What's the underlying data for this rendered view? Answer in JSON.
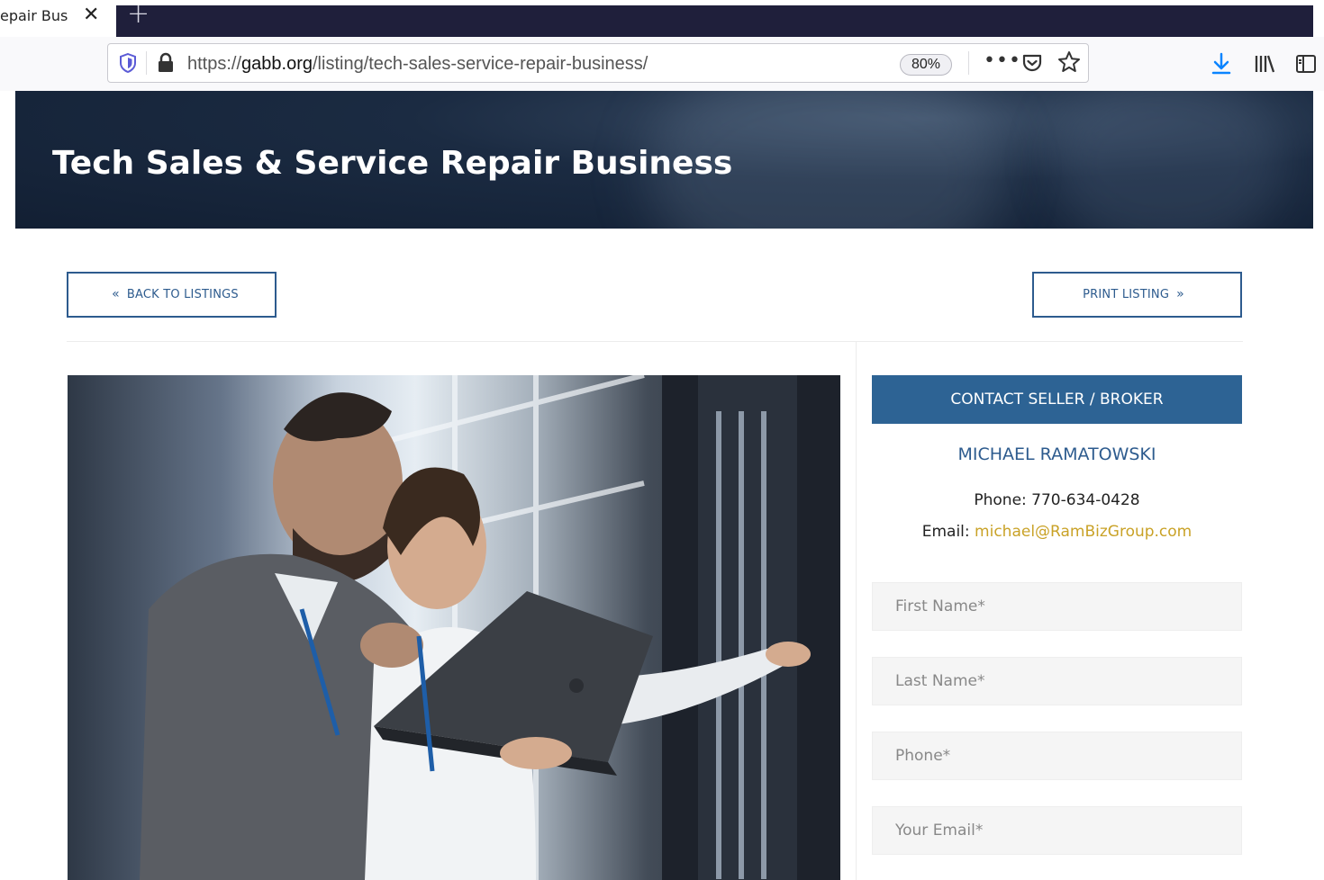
{
  "browser": {
    "tab_title": "epair Bus",
    "url_prefix": "https://",
    "url_domain": "gabb.org",
    "url_path": "/listing/tech-sales-service-repair-business/",
    "zoom": "80%",
    "icons": [
      "shield-icon",
      "lock-icon",
      "more-icon",
      "pocket-icon",
      "star-icon",
      "download-icon",
      "library-icon",
      "sidebar-icon"
    ]
  },
  "page": {
    "title": "Tech Sales & Service Repair Business",
    "back_button": "BACK TO LISTINGS",
    "print_button": "PRINT LISTING"
  },
  "contact": {
    "header": "CONTACT SELLER / BROKER",
    "name": "MICHAEL RAMATOWSKI",
    "phone_label": "Phone:",
    "phone": "770-634-0428",
    "email_label": "Email:",
    "email": "michael@RamBizGroup.com",
    "fields": {
      "first_name": "First Name*",
      "last_name": "Last Name*",
      "phone": "Phone*",
      "email": "Your Email*"
    }
  },
  "colors": {
    "accent": "#2d6394",
    "link": "#c9a227",
    "hero": "#1b2b42"
  }
}
